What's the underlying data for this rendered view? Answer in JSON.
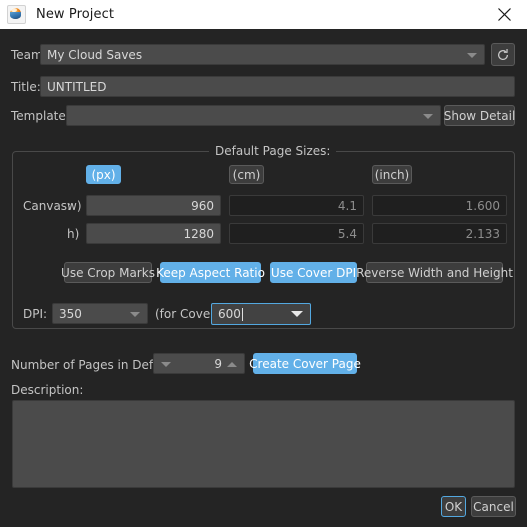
{
  "window": {
    "title": "New Project",
    "app_icon": "project-globe-icon",
    "close_icon": "close-icon",
    "background_color": "#242424",
    "titlebar_color": "#ffffff",
    "accent_color": "#62b0e8"
  },
  "team": {
    "label": "Team:",
    "value": "My Cloud Saves",
    "refresh_icon": "refresh-icon"
  },
  "title_field": {
    "label": "Title:",
    "value": "UNTITLED"
  },
  "template": {
    "label": "Template:",
    "value": "",
    "detail_button": "Show Detail"
  },
  "page_sizes": {
    "group_title": "Default Page Sizes:",
    "units": [
      {
        "label": "(px)",
        "active": true
      },
      {
        "label": "(cm)",
        "active": false
      },
      {
        "label": "(inch)",
        "active": false
      }
    ],
    "canvas_label": "Canvas:",
    "width_label": "w)",
    "height_label": "h)",
    "width": {
      "px": "960",
      "cm": "4.1",
      "inch": "1.600"
    },
    "height": {
      "px": "1280",
      "cm": "5.4",
      "inch": "2.133"
    },
    "toggles": [
      {
        "label": "Use Crop Marks",
        "active": false
      },
      {
        "label": "Keep Aspect Ratio",
        "active": true
      },
      {
        "label": "Use Cover DPI",
        "active": true
      },
      {
        "label": "Reverse Width and Height",
        "active": false
      }
    ],
    "dpi_label": "DPI:",
    "dpi_value": "350",
    "cover_label": "(for Cover)",
    "cover_dpi_value": "600"
  },
  "pages": {
    "label": "Number of Pages in Default:",
    "value": "9",
    "create_cover_button": "Create Cover Page"
  },
  "description": {
    "label": "Description:",
    "value": ""
  },
  "footer": {
    "ok_label": "OK",
    "cancel_label": "Cancel"
  }
}
